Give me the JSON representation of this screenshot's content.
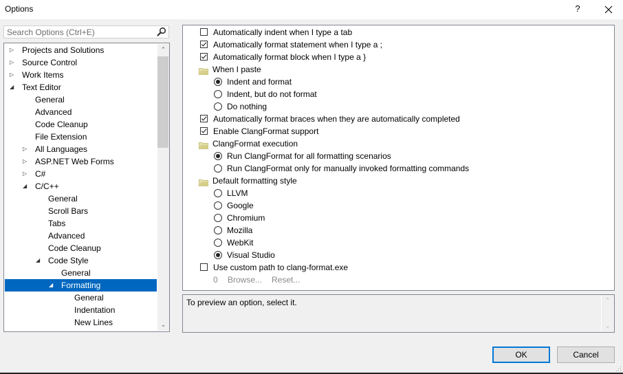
{
  "window": {
    "title": "Options",
    "help_label": "?",
    "close_label": "✕"
  },
  "search": {
    "placeholder": "Search Options (Ctrl+E)",
    "value": ""
  },
  "tree": {
    "items": [
      {
        "label": "Projects and Solutions",
        "level": 0,
        "expander": "collapsed"
      },
      {
        "label": "Source Control",
        "level": 0,
        "expander": "collapsed"
      },
      {
        "label": "Work Items",
        "level": 0,
        "expander": "collapsed"
      },
      {
        "label": "Text Editor",
        "level": 0,
        "expander": "expanded"
      },
      {
        "label": "General",
        "level": 1,
        "expander": "none"
      },
      {
        "label": "Advanced",
        "level": 1,
        "expander": "none"
      },
      {
        "label": "Code Cleanup",
        "level": 1,
        "expander": "none"
      },
      {
        "label": "File Extension",
        "level": 1,
        "expander": "none"
      },
      {
        "label": "All Languages",
        "level": 1,
        "expander": "collapsed"
      },
      {
        "label": "ASP.NET Web Forms",
        "level": 1,
        "expander": "collapsed"
      },
      {
        "label": "C#",
        "level": 1,
        "expander": "collapsed"
      },
      {
        "label": "C/C++",
        "level": 1,
        "expander": "expanded"
      },
      {
        "label": "General",
        "level": 2,
        "expander": "none"
      },
      {
        "label": "Scroll Bars",
        "level": 2,
        "expander": "none"
      },
      {
        "label": "Tabs",
        "level": 2,
        "expander": "none"
      },
      {
        "label": "Advanced",
        "level": 2,
        "expander": "none"
      },
      {
        "label": "Code Cleanup",
        "level": 2,
        "expander": "none"
      },
      {
        "label": "Code Style",
        "level": 2,
        "expander": "expanded"
      },
      {
        "label": "General",
        "level": 3,
        "expander": "none"
      },
      {
        "label": "Formatting",
        "level": 3,
        "expander": "expanded",
        "selected": true
      },
      {
        "label": "General",
        "level": 4,
        "expander": "none"
      },
      {
        "label": "Indentation",
        "level": 4,
        "expander": "none"
      },
      {
        "label": "New Lines",
        "level": 4,
        "expander": "none"
      }
    ],
    "scroll_up": "⌃",
    "scroll_down": "⌄"
  },
  "options": {
    "items": [
      {
        "type": "checkbox",
        "label": "Automatically indent when I type a tab",
        "checked": false,
        "indent": 0
      },
      {
        "type": "checkbox",
        "label": "Automatically format statement when I type a ;",
        "checked": true,
        "indent": 0
      },
      {
        "type": "checkbox",
        "label": "Automatically format block when I type a }",
        "checked": true,
        "indent": 0
      },
      {
        "type": "group",
        "label": "When I paste",
        "indent": 0
      },
      {
        "type": "radio",
        "label": "Indent and format",
        "checked": true,
        "indent": 1
      },
      {
        "type": "radio",
        "label": "Indent, but do not format",
        "checked": false,
        "indent": 1
      },
      {
        "type": "radio",
        "label": "Do nothing",
        "checked": false,
        "indent": 1
      },
      {
        "type": "checkbox",
        "label": "Automatically format braces when they are automatically completed",
        "checked": true,
        "indent": 0
      },
      {
        "type": "checkbox",
        "label": "Enable ClangFormat support",
        "checked": true,
        "indent": 0
      },
      {
        "type": "group",
        "label": "ClangFormat execution",
        "indent": 0
      },
      {
        "type": "radio",
        "label": "Run ClangFormat for all formatting scenarios",
        "checked": true,
        "indent": 1
      },
      {
        "type": "radio",
        "label": "Run ClangFormat only for manually invoked formatting commands",
        "checked": false,
        "indent": 1
      },
      {
        "type": "group",
        "label": "Default formatting style",
        "indent": 0
      },
      {
        "type": "radio",
        "label": "LLVM",
        "checked": false,
        "indent": 1
      },
      {
        "type": "radio",
        "label": "Google",
        "checked": false,
        "indent": 1
      },
      {
        "type": "radio",
        "label": "Chromium",
        "checked": false,
        "indent": 1
      },
      {
        "type": "radio",
        "label": "Mozilla",
        "checked": false,
        "indent": 1
      },
      {
        "type": "radio",
        "label": "WebKit",
        "checked": false,
        "indent": 1
      },
      {
        "type": "radio",
        "label": "Visual Studio",
        "checked": true,
        "indent": 1
      },
      {
        "type": "checkbox",
        "label": "Use custom path to clang-format.exe",
        "checked": false,
        "indent": 0
      }
    ],
    "custom_path": {
      "value": "0",
      "browse_label": "Browse...",
      "reset_label": "Reset..."
    }
  },
  "preview": {
    "text": "To preview an option, select it.",
    "scroll_up": "⌃",
    "scroll_down": "⌄"
  },
  "buttons": {
    "ok_label": "OK",
    "cancel_label": "Cancel"
  },
  "colors": {
    "selection": "#0067c0",
    "ok_border": "#0078d7",
    "folder": "#d6cf8a"
  }
}
